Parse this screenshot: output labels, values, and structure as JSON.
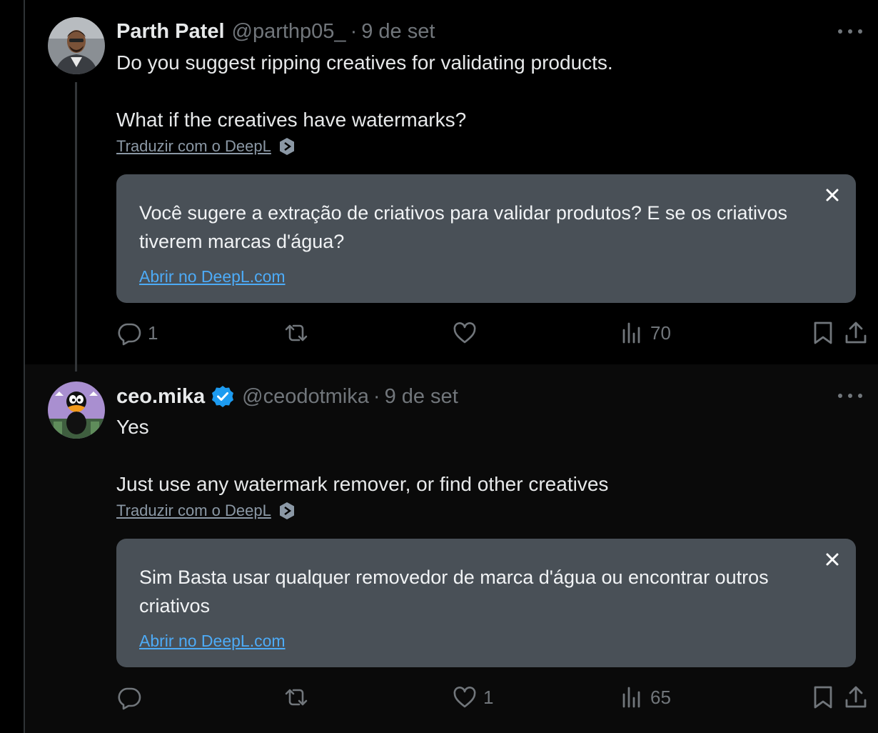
{
  "thread": [
    {
      "author_name": "Parth Patel",
      "handle": "@parthp05_",
      "separator": "·",
      "date": "9 de set",
      "text": "Do you suggest ripping creatives for validating products.\n\nWhat if the creatives have watermarks?",
      "translate_label": "Traduzir com o DeepL",
      "translation": "Você sugere a extração de criativos para validar produtos? E se os criativos tiverem marcas d'água?",
      "translation_link": "Abrir no DeepL.com",
      "replies": "1",
      "reposts": "",
      "likes": "",
      "views": "70"
    },
    {
      "author_name": "ceo.mika",
      "verified": true,
      "handle": "@ceodotmika",
      "separator": "·",
      "date": "9 de set",
      "text": "Yes\n\nJust use any watermark remover, or find other creatives",
      "translate_label": "Traduzir com o DeepL",
      "translation": "Sim Basta usar qualquer removedor de marca d'água ou encontrar outros criativos",
      "translation_link": "Abrir no DeepL.com",
      "replies": "",
      "reposts": "",
      "likes": "1",
      "views": "65"
    }
  ],
  "colors": {
    "background": "#000000",
    "secondary_text": "#71767b",
    "verified_badge": "#1d9bf0",
    "translation_box": "#495057",
    "link": "#4dabf7"
  }
}
